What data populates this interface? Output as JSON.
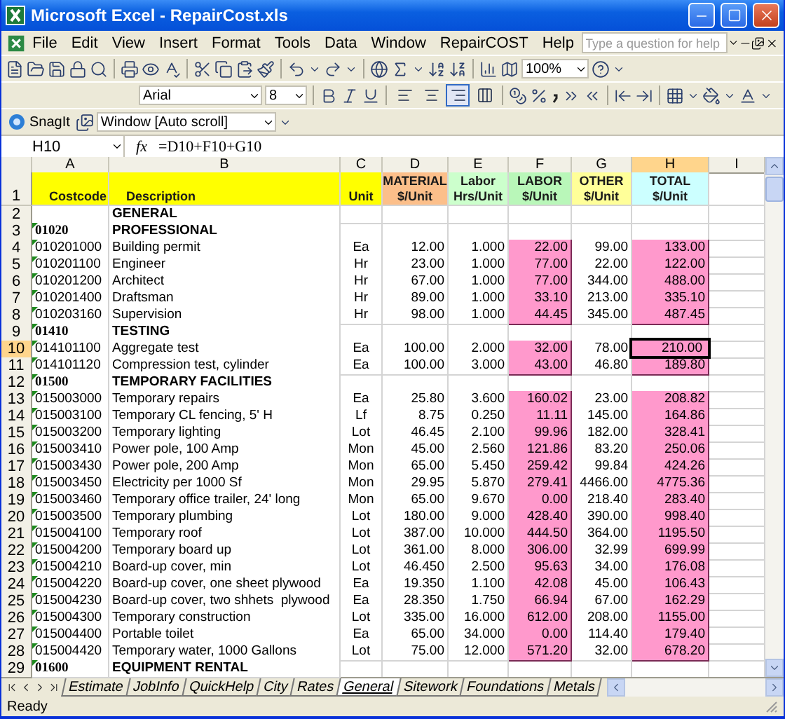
{
  "window": {
    "title": "Microsoft Excel - RepairCost.xls"
  },
  "menu": [
    "File",
    "Edit",
    "View",
    "Insert",
    "Format",
    "Tools",
    "Data",
    "Window",
    "RepairCOST",
    "Help"
  ],
  "help_search": {
    "placeholder": "Type a question for help"
  },
  "standard_toolbar": {
    "zoom": "100%"
  },
  "formatting": {
    "font": "Arial",
    "size": "8",
    "alignment_buttons": [
      {
        "selected": false
      },
      {
        "selected": false
      },
      {
        "selected": true
      },
      {
        "selected": false
      }
    ]
  },
  "snagit": {
    "button": "SnagIt",
    "dropdown": "Window [Auto scroll]"
  },
  "formula_bar": {
    "name_box": "H10",
    "fx": "fx",
    "formula": "=D10+F10+G10"
  },
  "columns": [
    {
      "label": "A",
      "selected": false
    },
    {
      "label": "B",
      "selected": false
    },
    {
      "label": "C",
      "selected": false
    },
    {
      "label": "D",
      "selected": false
    },
    {
      "label": "E",
      "selected": false
    },
    {
      "label": "F",
      "selected": false
    },
    {
      "label": "G",
      "selected": false
    },
    {
      "label": "H",
      "selected": true
    },
    {
      "label": "I",
      "selected": false
    }
  ],
  "rows": [
    {
      "number": "1",
      "selected": false,
      "kind": "header",
      "cells": [
        {
          "lines": [
            "Costcode"
          ],
          "color": "#ffff00"
        },
        {
          "lines": [
            "Description"
          ],
          "color": "#ffff00"
        },
        {
          "lines": [
            "Unit"
          ],
          "color": "#ffff00"
        },
        {
          "lines": [
            "MATERIAL",
            "$/Unit"
          ],
          "color": "#fcbf8a"
        },
        {
          "lines": [
            "Labor",
            "Hrs/Unit"
          ],
          "color": "#ccffcc"
        },
        {
          "lines": [
            "LABOR",
            "$/Unit"
          ],
          "color": "#b9f7b9"
        },
        {
          "lines": [
            "OTHER",
            "$/Unit"
          ],
          "color": "#ffff99"
        },
        {
          "lines": [
            "TOTAL",
            "$/Unit"
          ],
          "color": "#ccffff"
        }
      ]
    },
    {
      "number": "2",
      "selected": false,
      "kind": "section",
      "cells": [
        "",
        "GENERAL"
      ]
    },
    {
      "number": "3",
      "selected": false,
      "kind": "section",
      "cells": [
        "01020",
        "PROFESSIONAL"
      ]
    },
    {
      "number": "4",
      "selected": false,
      "kind": "item",
      "cells": [
        "010201000",
        "Building permit",
        "Ea",
        "12.00",
        "1.000",
        "22.00",
        "99.00",
        "133.00"
      ]
    },
    {
      "number": "5",
      "selected": false,
      "kind": "item",
      "cells": [
        "010201100",
        "Engineer",
        "Hr",
        "23.00",
        "1.000",
        "77.00",
        "22.00",
        "122.00"
      ]
    },
    {
      "number": "6",
      "selected": false,
      "kind": "item",
      "cells": [
        "010201200",
        "Architect",
        "Hr",
        "67.00",
        "1.000",
        "77.00",
        "344.00",
        "488.00"
      ]
    },
    {
      "number": "7",
      "selected": false,
      "kind": "item",
      "cells": [
        "010201400",
        "Draftsman",
        "Hr",
        "89.00",
        "1.000",
        "33.10",
        "213.00",
        "335.10"
      ]
    },
    {
      "number": "8",
      "selected": false,
      "kind": "item",
      "cells": [
        "010203160",
        "Supervision",
        "Hr",
        "98.00",
        "1.000",
        "44.45",
        "345.00",
        "487.45"
      ]
    },
    {
      "number": "9",
      "selected": false,
      "kind": "section",
      "cells": [
        "01410",
        "TESTING"
      ]
    },
    {
      "number": "10",
      "selected": true,
      "kind": "item",
      "cells": [
        "014101100",
        "Aggregate test",
        "Ea",
        "100.00",
        "2.000",
        "32.00",
        "78.00",
        "210.00"
      ]
    },
    {
      "number": "11",
      "selected": false,
      "kind": "item",
      "cells": [
        "014101120",
        "Compression test, cylinder",
        "Ea",
        "100.00",
        "3.000",
        "43.00",
        "46.80",
        "189.80"
      ]
    },
    {
      "number": "12",
      "selected": false,
      "kind": "section",
      "cells": [
        "01500",
        "TEMPORARY FACILITIES"
      ]
    },
    {
      "number": "13",
      "selected": false,
      "kind": "item",
      "cells": [
        "015003000",
        "Temporary repairs",
        "Ea",
        "25.80",
        "3.600",
        "160.02",
        "23.00",
        "208.82"
      ]
    },
    {
      "number": "14",
      "selected": false,
      "kind": "item",
      "cells": [
        "015003100",
        "Temporary CL fencing, 5' H",
        "Lf",
        "8.75",
        "0.250",
        "11.11",
        "145.00",
        "164.86"
      ]
    },
    {
      "number": "15",
      "selected": false,
      "kind": "item",
      "cells": [
        "015003200",
        "Temporary lighting",
        "Lot",
        "46.45",
        "2.100",
        "99.96",
        "182.00",
        "328.41"
      ]
    },
    {
      "number": "16",
      "selected": false,
      "kind": "item",
      "cells": [
        "015003410",
        "Power pole, 100 Amp",
        "Mon",
        "45.00",
        "2.560",
        "121.86",
        "83.20",
        "250.06"
      ]
    },
    {
      "number": "17",
      "selected": false,
      "kind": "item",
      "cells": [
        "015003430",
        "Power pole, 200 Amp",
        "Mon",
        "65.00",
        "5.450",
        "259.42",
        "99.84",
        "424.26"
      ]
    },
    {
      "number": "18",
      "selected": false,
      "kind": "item",
      "cells": [
        "015003450",
        "Electricity per 1000 Sf",
        "Mon",
        "29.95",
        "5.870",
        "279.41",
        "4466.00",
        "4775.36"
      ]
    },
    {
      "number": "19",
      "selected": false,
      "kind": "item",
      "cells": [
        "015003460",
        "Temporary office trailer, 24' long",
        "Mon",
        "65.00",
        "9.670",
        "0.00",
        "218.40",
        "283.40"
      ]
    },
    {
      "number": "20",
      "selected": false,
      "kind": "item",
      "cells": [
        "015003500",
        "Temporary plumbing",
        "Lot",
        "180.00",
        "9.000",
        "428.40",
        "390.00",
        "998.40"
      ]
    },
    {
      "number": "21",
      "selected": false,
      "kind": "item",
      "cells": [
        "015004100",
        "Temporary roof",
        "Lot",
        "387.00",
        "10.000",
        "444.50",
        "364.00",
        "1195.50"
      ]
    },
    {
      "number": "22",
      "selected": false,
      "kind": "item",
      "cells": [
        "015004200",
        "Temporary board up",
        "Lot",
        "361.00",
        "8.000",
        "306.00",
        "32.99",
        "699.99"
      ]
    },
    {
      "number": "23",
      "selected": false,
      "kind": "item",
      "cells": [
        "015004210",
        "Board-up cover, min",
        "Lot",
        "46.450",
        "2.500",
        "95.63",
        "34.00",
        "176.08"
      ]
    },
    {
      "number": "24",
      "selected": false,
      "kind": "item",
      "cells": [
        "015004220",
        "Board-up cover, one sheet plywood",
        "Ea",
        "19.350",
        "1.100",
        "42.08",
        "45.00",
        "106.43"
      ]
    },
    {
      "number": "25",
      "selected": false,
      "kind": "item",
      "cells": [
        "015004230",
        "Board-up cover, two shhets  plywood",
        "Ea",
        "28.350",
        "1.750",
        "66.94",
        "67.00",
        "162.29"
      ]
    },
    {
      "number": "26",
      "selected": false,
      "kind": "item",
      "cells": [
        "015004300",
        "Temporary construction",
        "Lot",
        "335.00",
        "16.000",
        "612.00",
        "208.00",
        "1155.00"
      ]
    },
    {
      "number": "27",
      "selected": false,
      "kind": "item",
      "cells": [
        "015004400",
        "Portable toilet",
        "Ea",
        "65.00",
        "34.000",
        "0.00",
        "114.40",
        "179.40"
      ]
    },
    {
      "number": "28",
      "selected": false,
      "kind": "item",
      "cells": [
        "015004420",
        "Temporary water, 1000 Gallons",
        "Lot",
        "75.00",
        "12.000",
        "571.20",
        "32.00",
        "678.20"
      ]
    },
    {
      "number": "29",
      "selected": false,
      "kind": "section",
      "cells": [
        "01600",
        "EQUIPMENT RENTAL"
      ]
    }
  ],
  "sheet_tabs": [
    {
      "label": "Estimate",
      "selected": false
    },
    {
      "label": "JobInfo",
      "selected": false
    },
    {
      "label": "QuickHelp",
      "selected": false
    },
    {
      "label": "City",
      "selected": false
    },
    {
      "label": "Rates",
      "selected": false
    },
    {
      "label": "General",
      "selected": true
    },
    {
      "label": "Sitework",
      "selected": false
    },
    {
      "label": "Foundations",
      "selected": false
    },
    {
      "label": "Metals",
      "selected": false
    }
  ],
  "status_bar": {
    "text": "Ready"
  }
}
